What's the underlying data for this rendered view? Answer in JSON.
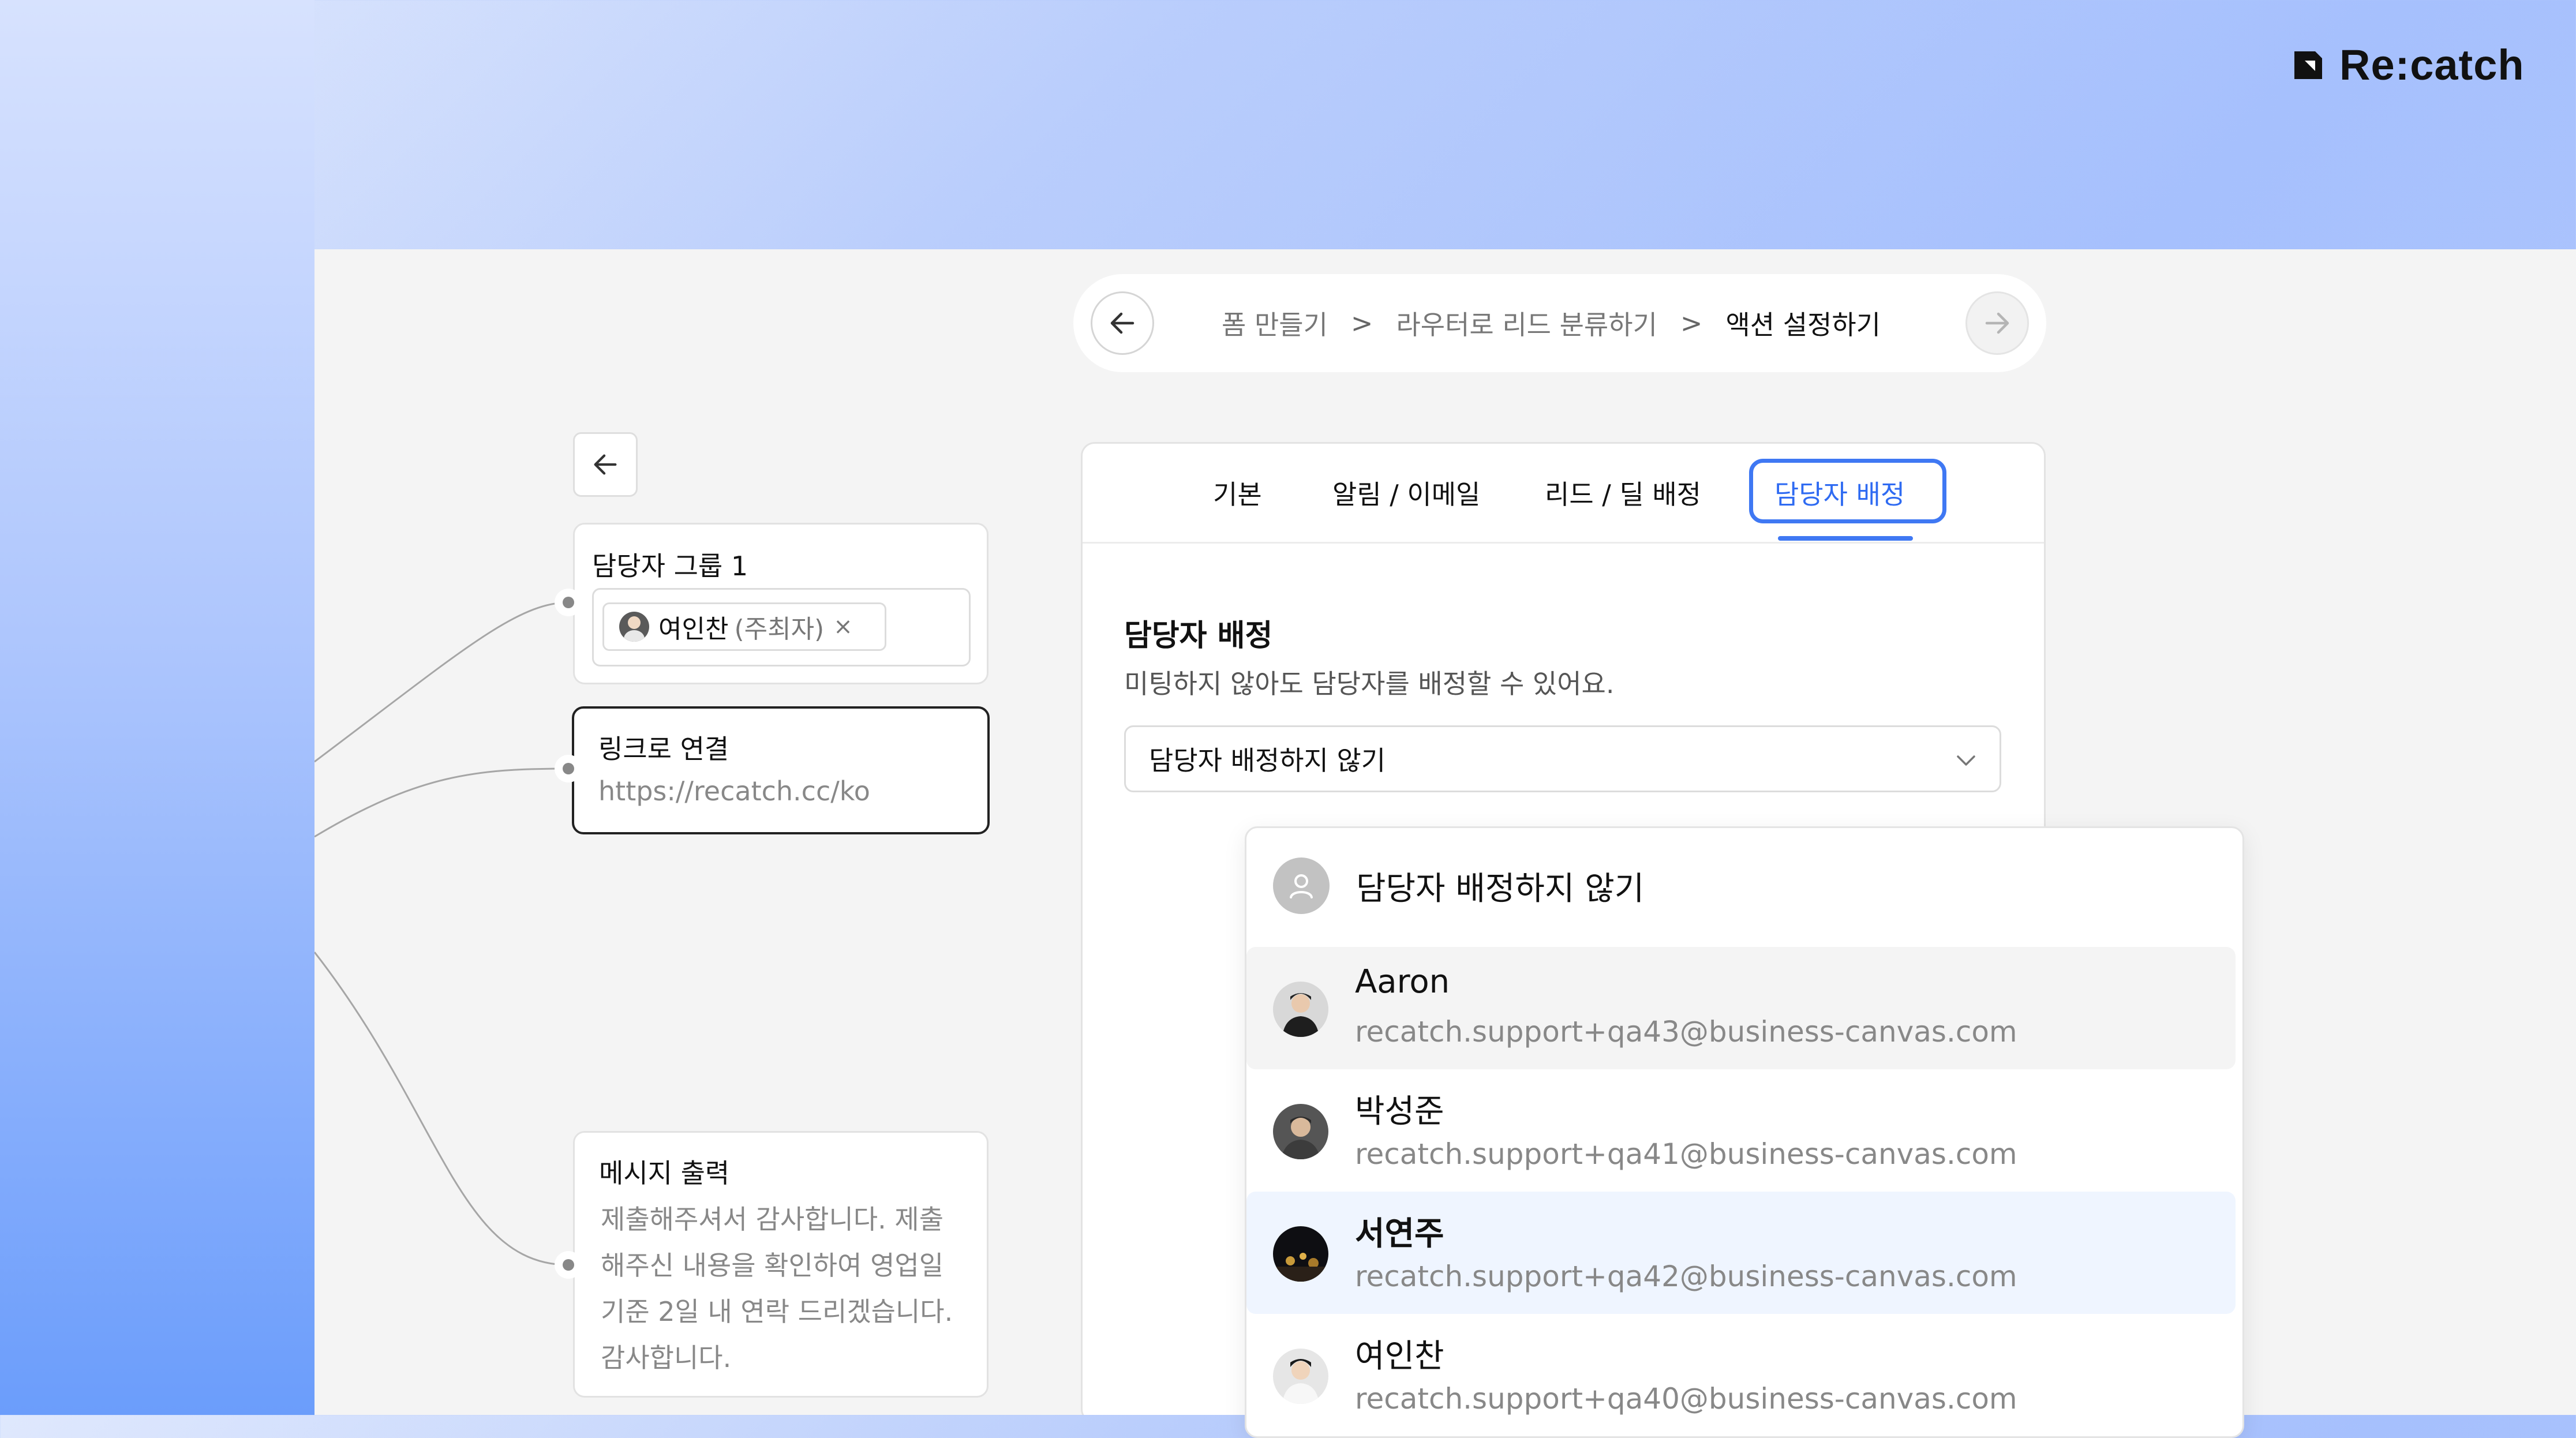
{
  "brand": {
    "name": "Re:catch"
  },
  "breadcrumb": {
    "steps": [
      "폼 만들기",
      "라우터로 리드 분류하기",
      "액션 설정하기"
    ],
    "separator": ">",
    "back_icon": "arrow-left-icon",
    "next_icon": "arrow-right-icon"
  },
  "nodes": {
    "assignee_group": {
      "title": "담당자 그룹 1",
      "chip_name": "여인찬",
      "chip_role": "(주최자)",
      "chip_remove": "×"
    },
    "link": {
      "title": "링크로 연결",
      "url": "https://recatch.cc/ko"
    },
    "message": {
      "title": "메시지 출력",
      "lines": [
        "제출해주셔서 감사합니다. 제출",
        "해주신 내용을 확인하여 영업일",
        "기준 2일 내 연락 드리겠습니다.",
        "감사합니다."
      ]
    }
  },
  "panel": {
    "tabs": [
      "기본",
      "알림 / 이메일",
      "리드 / 딜 배정",
      "담당자 배정"
    ],
    "active_tab": "담당자 배정",
    "section_title": "담당자 배정",
    "section_desc": "미팅하지 않아도 담당자를 배정할 수 있어요.",
    "select_value": "담당자 배정하지 않기"
  },
  "dropdown": {
    "none_option": "담당자 배정하지 않기",
    "options": [
      {
        "name": "Aaron",
        "email": "recatch.support+qa43@business-canvas.com",
        "state": "hover"
      },
      {
        "name": "박성준",
        "email": "recatch.support+qa41@business-canvas.com",
        "state": "normal"
      },
      {
        "name": "서연주",
        "email": "recatch.support+qa42@business-canvas.com",
        "state": "selected"
      },
      {
        "name": "여인찬",
        "email": "recatch.support+qa40@business-canvas.com",
        "state": "normal"
      }
    ]
  },
  "colors": {
    "accent": "#3f78f3",
    "selected_bg": "#eff5ff",
    "hover_bg": "#f4f4f4"
  }
}
